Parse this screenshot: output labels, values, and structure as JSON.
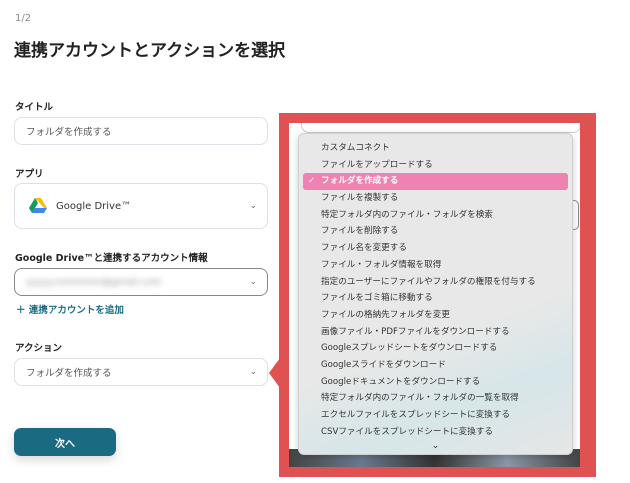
{
  "step": "1/2",
  "page_title": "連携アカウントとアクションを選択",
  "title_field": {
    "label": "タイトル",
    "value": "フォルダを作成する"
  },
  "app_field": {
    "label": "アプリ",
    "value": "Google Drive™"
  },
  "account_field": {
    "label": "Google Drive™と連携するアカウント情報",
    "value": "yyyyy.mmmmm@gmail.com"
  },
  "add_account": "連携アカウントを追加",
  "action_field": {
    "label": "アクション",
    "value": "フォルダを作成する"
  },
  "next_button": "次へ",
  "menu": {
    "selected_index": 2,
    "items": [
      "カスタムコネクト",
      "ファイルをアップロードする",
      "フォルダを作成する",
      "ファイルを複製する",
      "特定フォルダ内のファイル・フォルダを検索",
      "ファイルを削除する",
      "ファイル名を変更する",
      "ファイル・フォルダ情報を取得",
      "指定のユーザーにファイルやフォルダの権限を付与する",
      "ファイルをゴミ箱に移動する",
      "ファイルの格納先フォルダを変更",
      "画像ファイル・PDFファイルをダウンロードする",
      "Googleスプレッドシートをダウンロードする",
      "Googleスライドをダウンロード",
      "Googleドキュメントをダウンロードする",
      "特定フォルダ内のファイル・フォルダの一覧を取得",
      "エクセルファイルをスプレッドシートに変換する",
      "CSVファイルをスプレッドシートに変換する"
    ]
  },
  "colors": {
    "highlight": "#e05252",
    "selected": "#ee82b0",
    "primary": "#1a6a82"
  }
}
